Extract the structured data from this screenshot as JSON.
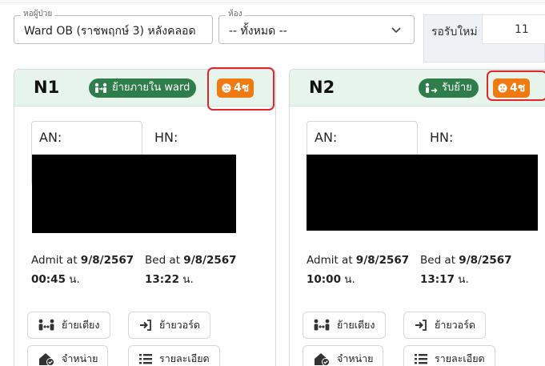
{
  "filters": {
    "ward_legend": "หอผู้ป่วย",
    "ward_value": "Ward OB (ราชพฤกษ์ 3) หลังคลอด",
    "room_legend": "ห้อง",
    "room_value": "-- ทั้งหมด --"
  },
  "waiting": {
    "label": "รอรับใหม่",
    "count": "11"
  },
  "cards": [
    {
      "title": "N1",
      "move_badge": "ย้ายภายใน ward",
      "time_badge": "4ช",
      "an_label": "AN:",
      "hn_label": "HN:",
      "admit_label": "Admit at",
      "admit_date": "9/8/2567",
      "admit_time": "00:45",
      "bed_label": "Bed at",
      "bed_date": "9/8/2567",
      "bed_time": "13:22",
      "unit": "น.",
      "actions": {
        "move_bed": "ย้ายเตียง",
        "move_ward": "ย้ายวอร์ด",
        "discharge": "จำหน่าย",
        "details": "รายละเอียด"
      }
    },
    {
      "title": "N2",
      "move_badge": "รับย้าย",
      "time_badge": "4ช",
      "an_label": "AN:",
      "hn_label": "HN:",
      "admit_label": "Admit at",
      "admit_date": "9/8/2567",
      "admit_time": "10:00",
      "bed_label": "Bed at",
      "bed_date": "9/8/2567",
      "bed_time": "13:17",
      "unit": "น.",
      "actions": {
        "move_bed": "ย้ายเตียง",
        "move_ward": "ย้ายวอร์ด",
        "discharge": "จำหน่าย",
        "details": "รายละเอียด"
      }
    }
  ],
  "colors": {
    "header_bg": "#e6f4ec",
    "badge_green": "#2e7d4a",
    "badge_orange": "#f07a12",
    "highlight_red": "#e0252d"
  }
}
